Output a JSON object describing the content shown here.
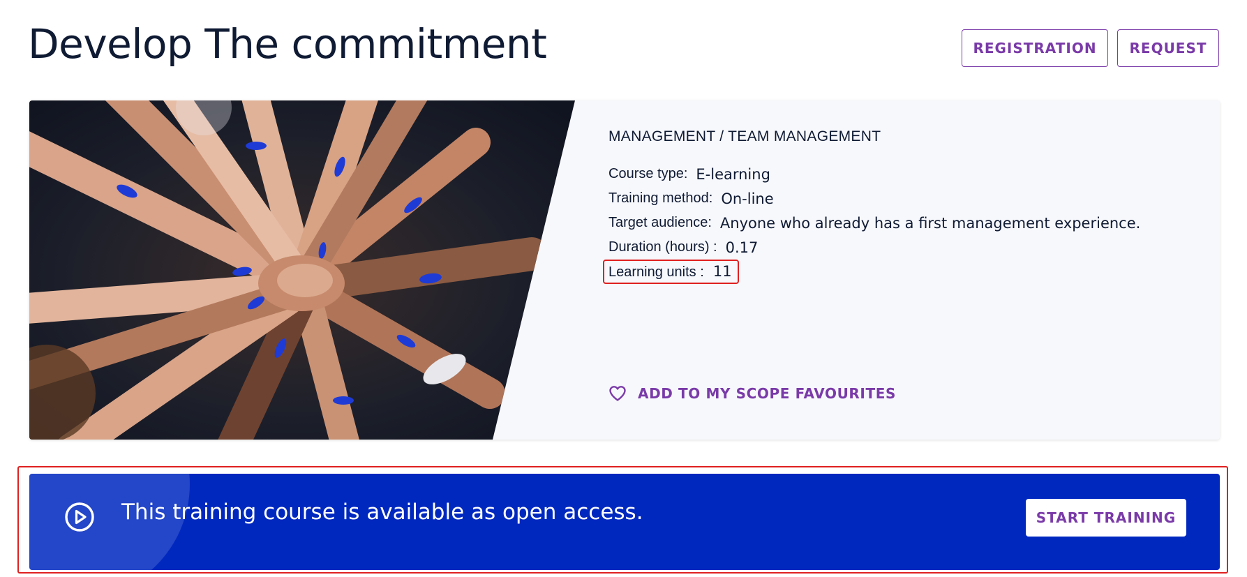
{
  "page": {
    "title": "Develop The commitment"
  },
  "header": {
    "registration_label": "REGISTRATION",
    "request_label": "REQUEST"
  },
  "course": {
    "image_icon": "team-hands-photo",
    "category": "MANAGEMENT / TEAM MANAGEMENT",
    "details": [
      {
        "label": "Course type:",
        "value": "E-learning"
      },
      {
        "label": "Training method:",
        "value": "On-line"
      },
      {
        "label": "Target audience:",
        "value": "Anyone who already has a first management experience."
      },
      {
        "label": "Duration (hours) :",
        "value": "0.17"
      },
      {
        "label": "Learning units :",
        "value": "11"
      }
    ],
    "favourites_icon": "heart-outline-icon",
    "favourites_label": "ADD TO MY SCOPE FAVOURITES"
  },
  "banner": {
    "icon": "play-circle-icon",
    "text": "This training course is available as open access.",
    "start_label": "START TRAINING"
  },
  "colors": {
    "title_text": "#0f1a33",
    "accent_purple": "#7a3aa8",
    "banner_blue": "#0028bf",
    "card_background": "#f7f8fc",
    "highlight_red": "#e02020"
  }
}
